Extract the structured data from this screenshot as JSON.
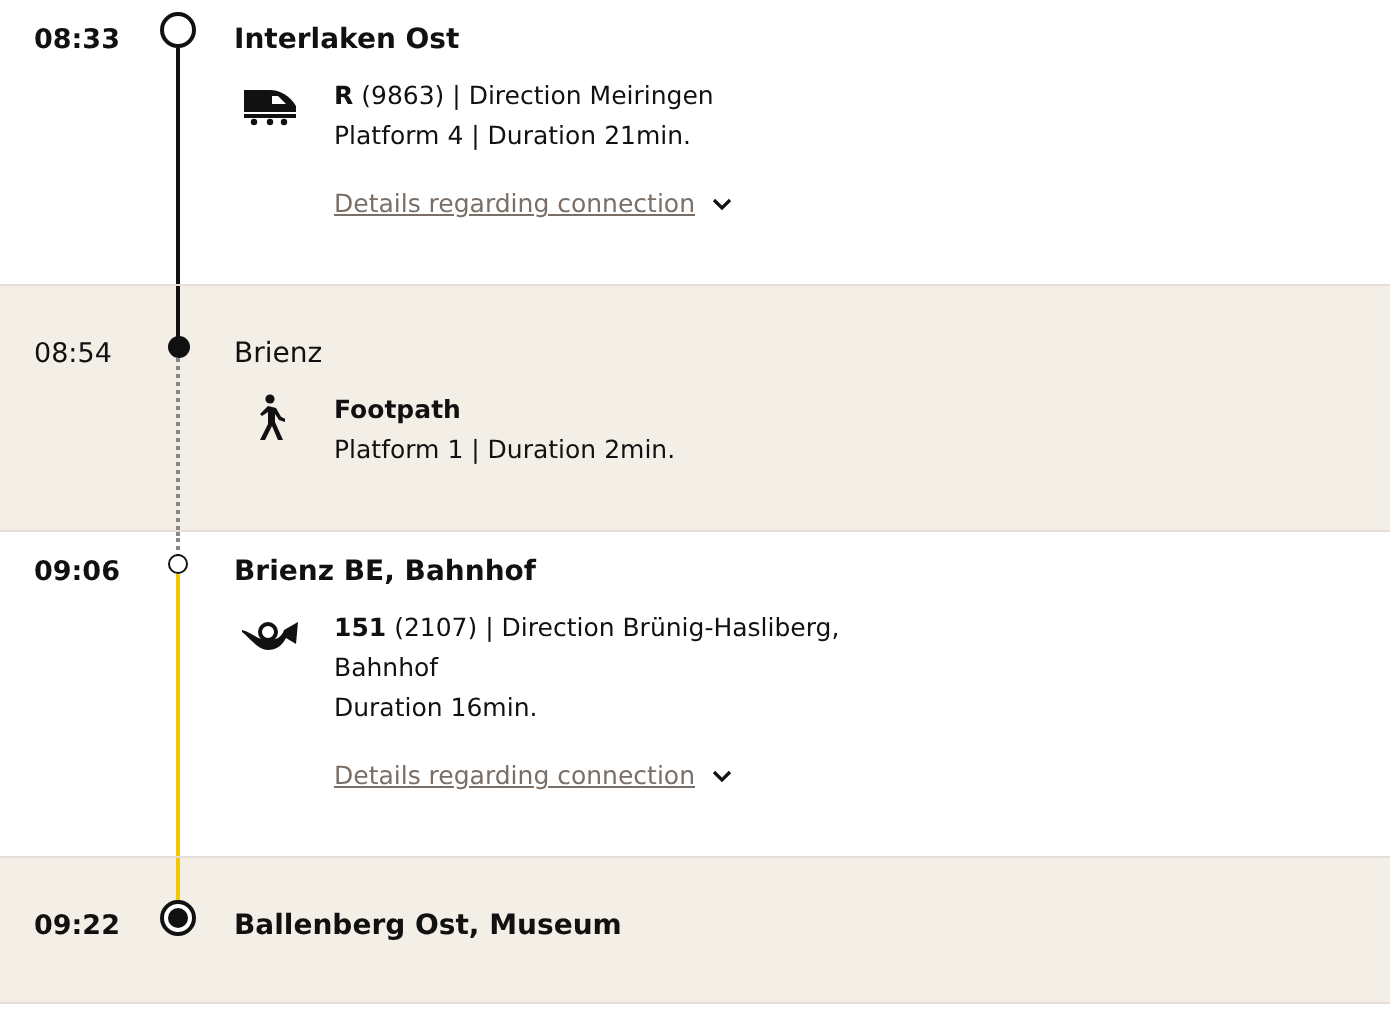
{
  "stops": [
    {
      "kind": "origin",
      "time": "08:33",
      "station": "Interlaken Ost",
      "shaded": false,
      "leg": {
        "kind": "train",
        "lines": [
          "**R** (9863) | Direction Meiringen",
          "Platform 4 | Duration 21min."
        ],
        "details": "Details regarding connection"
      }
    },
    {
      "kind": "transfer",
      "time": "08:54",
      "station": "Brienz",
      "shaded": true,
      "leg": {
        "kind": "walk",
        "lines": [
          "**Footpath**",
          "Platform 1 | Duration 2min."
        ]
      }
    },
    {
      "kind": "change",
      "time": "09:06",
      "station": "Brienz BE, Bahnhof",
      "shaded": false,
      "leg": {
        "kind": "bus",
        "lines": [
          "**151** (2107) | Direction Brünig-Hasliberg, Bahnhof",
          "Duration 16min."
        ],
        "details": "Details regarding connection"
      }
    },
    {
      "kind": "destination",
      "time": "09:22",
      "station": "Ballenberg Ost, Museum",
      "shaded": true
    }
  ]
}
